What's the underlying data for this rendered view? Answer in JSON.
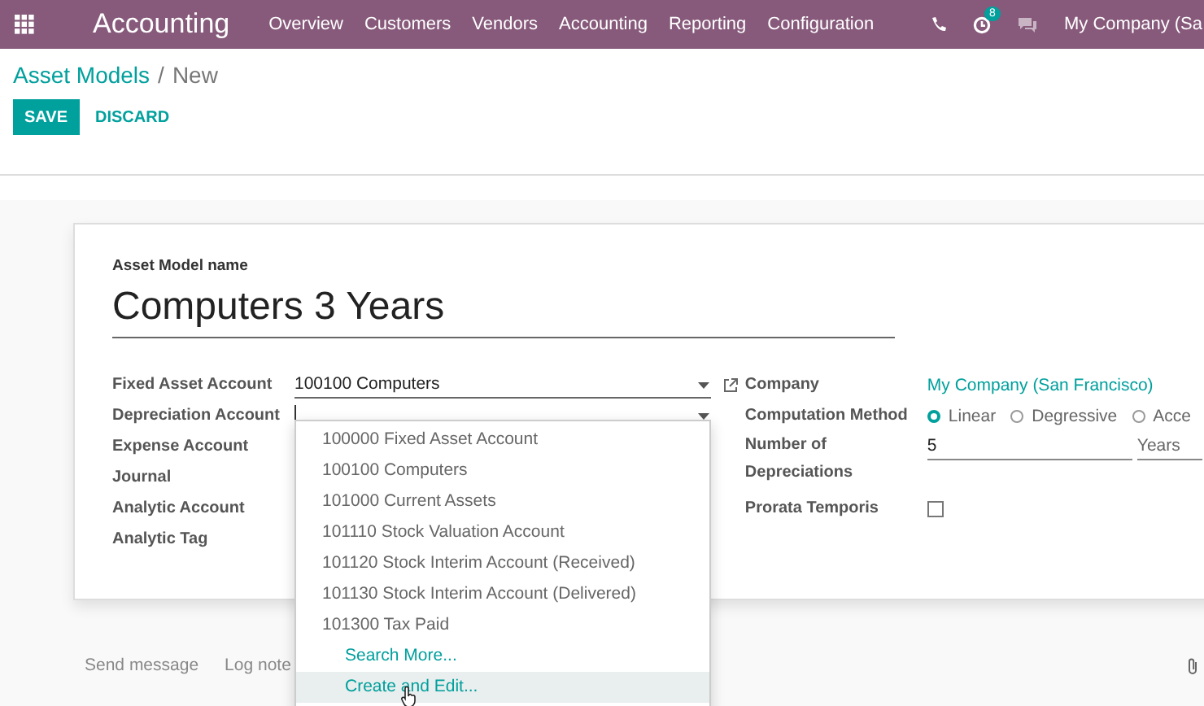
{
  "navbar": {
    "app_title": "Accounting",
    "menu": [
      "Overview",
      "Customers",
      "Vendors",
      "Accounting",
      "Reporting",
      "Configuration"
    ],
    "activity_count": "8",
    "company": "My Company (Sa"
  },
  "breadcrumb": {
    "parent": "Asset Models",
    "separator": "/",
    "current": "New"
  },
  "buttons": [
    "SAVE",
    "DISCARD"
  ],
  "form": {
    "name_label": "Asset Model name",
    "name_value": "Computers 3 Years",
    "left_fields": [
      {
        "label": "Fixed Asset Account",
        "kind": "many2one",
        "value": "100100 Computers",
        "focused": false
      },
      {
        "label": "Depreciation Account",
        "kind": "many2one",
        "focused": true
      },
      {
        "label": "Expense Account",
        "kind": "hidden"
      },
      {
        "label": "Journal",
        "kind": "hidden"
      },
      {
        "label": "Analytic Account",
        "kind": "hidden"
      },
      {
        "label": "Analytic Tag",
        "kind": "hidden"
      }
    ],
    "company": {
      "label": "Company",
      "value": "My Company (San Francisco)"
    },
    "computation": {
      "label": "Computation Method",
      "options": [
        {
          "label": "Linear",
          "selected": true
        },
        {
          "label": "Degressive",
          "selected": false
        },
        {
          "label": "Acce",
          "selected": false
        }
      ]
    },
    "depreciations": {
      "label_line1": "Number of",
      "label_line2": "Depreciations",
      "value": "5",
      "unit": "Years"
    },
    "prorata": {
      "label": "Prorata Temporis",
      "checked": false
    }
  },
  "dropdown": [
    {
      "kind": "account",
      "label": "100000 Fixed Asset Account",
      "selected": false
    },
    {
      "kind": "account",
      "label": "100100 Computers",
      "selected": false
    },
    {
      "kind": "account",
      "label": "101000 Current Assets",
      "selected": false
    },
    {
      "kind": "account",
      "label": "101110 Stock Valuation Account",
      "selected": false
    },
    {
      "kind": "account",
      "label": "101120 Stock Interim Account (Received)",
      "selected": false
    },
    {
      "kind": "account",
      "label": "101130 Stock Interim Account (Delivered)",
      "selected": false
    },
    {
      "kind": "account",
      "label": "101300 Tax Paid",
      "selected": false
    },
    {
      "kind": "action",
      "label": "Search More...",
      "selected": false
    },
    {
      "kind": "action",
      "label": "Create and Edit...",
      "selected": true
    }
  ],
  "chatter": [
    "Send message",
    "Log note"
  ]
}
